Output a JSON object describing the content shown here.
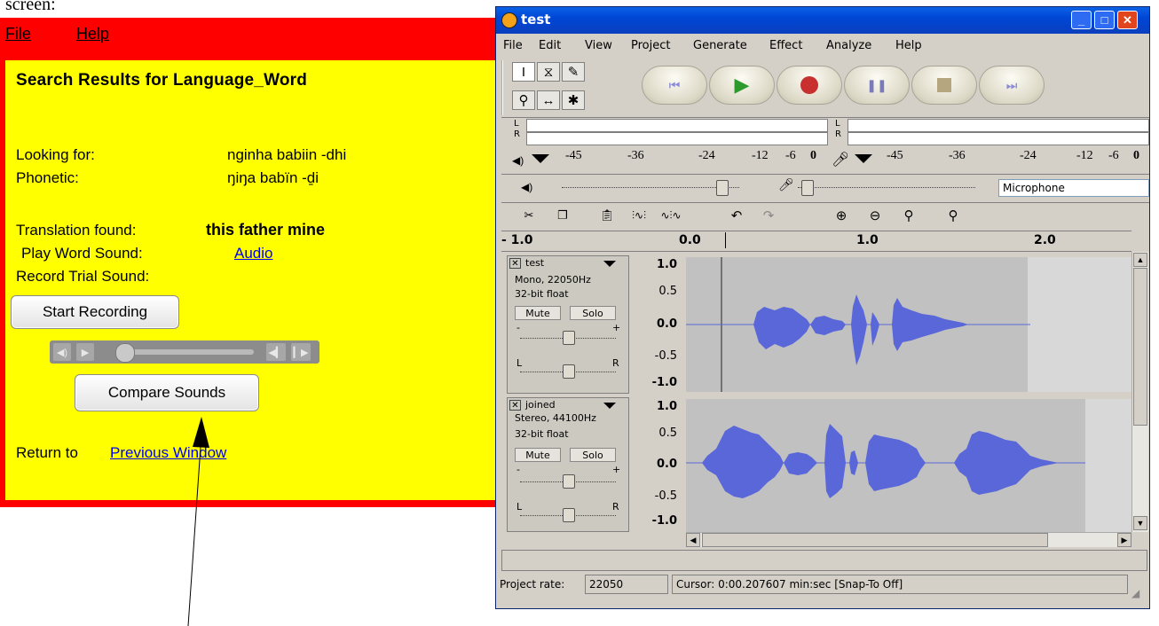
{
  "doc_caption": "screen:",
  "language_app": {
    "menu": [
      "File",
      "Help"
    ],
    "heading": "Search Results for Language_Word",
    "looking_for_label": "Looking for:",
    "looking_for_value": "nginha  babiin -dhi",
    "phonetic_label": "Phonetic:",
    "phonetic_value": "ŋiŋa  babïn -ḏi",
    "translation_label": "Translation found:",
    "translation_value": "this  father  mine",
    "play_label": "Play Word Sound:",
    "play_link": "Audio",
    "record_label": "Record Trial Sound:",
    "start_recording": "Start Recording",
    "compare_sounds": "Compare Sounds",
    "return_label": "Return to",
    "return_link": "Previous Window",
    "colors": {
      "window": "#ff0000",
      "panel": "#ffff00",
      "link": "#0000ee"
    }
  },
  "audacity": {
    "title": "test",
    "menu": [
      "File",
      "Edit",
      "View",
      "Project",
      "Generate",
      "Effect",
      "Analyze",
      "Help"
    ],
    "tools": [
      "selection-tool",
      "envelope-tool",
      "draw-tool",
      "zoom-tool",
      "timeshift-tool",
      "multi-tool"
    ],
    "transport": [
      "skip-start",
      "play",
      "record",
      "pause",
      "stop",
      "skip-end"
    ],
    "meter_labels": {
      "left": "L",
      "right": "R"
    },
    "meter_scale_play": [
      "-45",
      "-36",
      "-24",
      "-12",
      "-6",
      "0"
    ],
    "meter_scale_rec": [
      "-45",
      "-36",
      "-24",
      "-12",
      "-6",
      "0"
    ],
    "input_source": "Microphone",
    "ruler": [
      "- 1.0",
      "0.0",
      "1.0",
      "2.0"
    ],
    "tracks": [
      {
        "name": "test",
        "info1": "Mono, 22050Hz",
        "info2": "32-bit float",
        "mute": "Mute",
        "solo": "Solo",
        "gain_minus": "-",
        "gain_plus": "+",
        "pan_l": "L",
        "pan_r": "R",
        "scale": [
          "1.0",
          "0.5",
          "0.0",
          "-0.5",
          "-1.0"
        ]
      },
      {
        "name": "joined",
        "info1": "Stereo, 44100Hz",
        "info2": "32-bit float",
        "mute": "Mute",
        "solo": "Solo",
        "gain_minus": "-",
        "gain_plus": "+",
        "pan_l": "L",
        "pan_r": "R",
        "scale": [
          "1.0",
          "0.5",
          "0.0",
          "-0.5",
          "-1.0"
        ]
      }
    ],
    "project_rate_label": "Project rate:",
    "project_rate_value": "22050",
    "cursor_status": "Cursor: 0:00.207607 min:sec  [Snap-To Off]",
    "colors": {
      "waveform": "#5a67d8",
      "title_bar": "#0046d5",
      "face": "#d4d0c8"
    }
  }
}
